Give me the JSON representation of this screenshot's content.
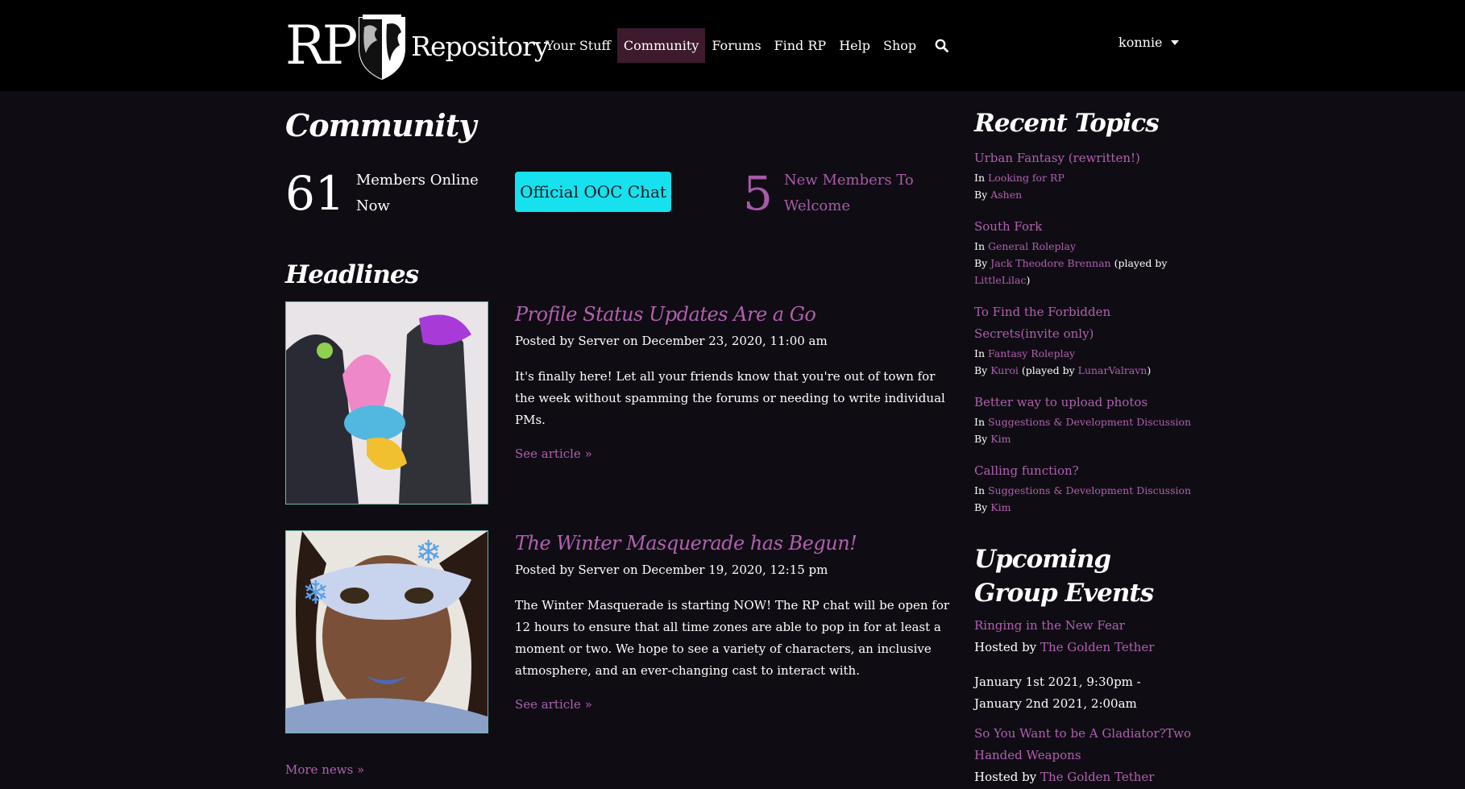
{
  "site": {
    "logo_rp": "RP",
    "logo_repo": "Repository"
  },
  "nav": {
    "items": [
      "Your Stuff",
      "Community",
      "Forums",
      "Find RP",
      "Help",
      "Shop"
    ],
    "active": "Community",
    "user": "konnie"
  },
  "main": {
    "title": "Community",
    "members_online": {
      "count": "61",
      "label": "Members Online Now"
    },
    "ooc_button": "Official OOC Chat",
    "new_members": {
      "count": "5",
      "label": "New Members To Welcome"
    },
    "headlines_title": "Headlines",
    "articles": [
      {
        "title": "Profile Status Updates Are a Go",
        "meta": "Posted by Server on December 23, 2020, 11:00 am",
        "text": "It's finally here! Let all your friends know that you're out of town for the week without spamming the forums or needing to write individual PMs.",
        "link": "See article »"
      },
      {
        "title": "The Winter Masquerade has Begun!",
        "meta": "Posted by Server on December 19, 2020, 12:15 pm",
        "text": "The Winter Masquerade is starting NOW! The RP chat will be open for 12 hours to ensure that all time zones are able to pop in for at least a moment or two. We hope to see a variety of characters, an inclusive atmosphere, and an ever-changing cast to interact with.",
        "link": "See article »"
      }
    ],
    "more_news": "More news »"
  },
  "sidebar": {
    "recent_topics_title": "Recent Topics",
    "topics": [
      {
        "title": "Urban Fantasy (rewritten!)",
        "in_label": "In",
        "forum": "Looking for RP",
        "by_label": "By",
        "author": "Ashen"
      },
      {
        "title": "South Fork",
        "in_label": "In",
        "forum": "General Roleplay",
        "by_label": "By",
        "author": "Jack Theodore Brennan",
        "played_prefix": "(played by",
        "player": "LittleLilac",
        "played_suffix": ")"
      },
      {
        "title": "To Find the Forbidden Secrets(invite only)",
        "in_label": "In",
        "forum": "Fantasy Roleplay",
        "by_label": "By",
        "author": "Kuroi",
        "played_prefix": "(played by",
        "player": "LunarValravn",
        "played_suffix": ")"
      },
      {
        "title": "Better way to upload photos",
        "in_label": "In",
        "forum": "Suggestions & Development Discussion",
        "by_label": "By",
        "author": "Kim"
      },
      {
        "title": "Calling function?",
        "in_label": "In",
        "forum": "Suggestions & Development Discussion",
        "by_label": "By",
        "author": "Kim"
      }
    ],
    "events_title": "Upcoming Group Events",
    "events": [
      {
        "title": "Ringing in the New Fear",
        "hosted_label": "Hosted by",
        "host": "The Golden Tether",
        "date": "January 1st 2021, 9:30pm - January 2nd 2021, 2:00am"
      },
      {
        "title": "So You Want to be A Gladiator?Two Handed Weapons",
        "hosted_label": "Hosted by",
        "host": "The Golden Tether"
      }
    ]
  },
  "colors": {
    "accent": "#b25fb0",
    "ooc_button": "#17e1ee",
    "active_nav": "#3d1a2d",
    "background": "#0f0d13"
  }
}
